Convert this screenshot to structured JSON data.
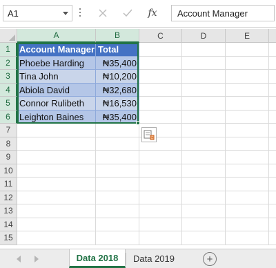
{
  "formula_bar": {
    "name_box": "A1",
    "formula_value": "Account Manager",
    "fx_label": "fx"
  },
  "columns": [
    "A",
    "B",
    "C",
    "D",
    "E"
  ],
  "rows": [
    "1",
    "2",
    "3",
    "4",
    "5",
    "6",
    "7",
    "8",
    "9",
    "10",
    "11",
    "12",
    "13",
    "14",
    "15"
  ],
  "table": {
    "headers": [
      "Account Manager",
      "Total"
    ],
    "rows": [
      [
        "Phoebe Harding",
        "₦35,400"
      ],
      [
        "Tina John",
        "₦10,200"
      ],
      [
        "Abiola David",
        "₦32,680"
      ],
      [
        "Connor Rulibeth",
        "₦16,530"
      ],
      [
        "Leighton Baines",
        "₦35,400"
      ]
    ]
  },
  "sheet_tabs": [
    {
      "label": "Data 2018",
      "active": true
    },
    {
      "label": "Data 2019",
      "active": false
    }
  ],
  "add_sheet_label": "+",
  "colors": {
    "accent": "#217346",
    "table_header": "#4472c4",
    "band_a": "#b4c6e7",
    "band_b": "#c9d5ea"
  }
}
